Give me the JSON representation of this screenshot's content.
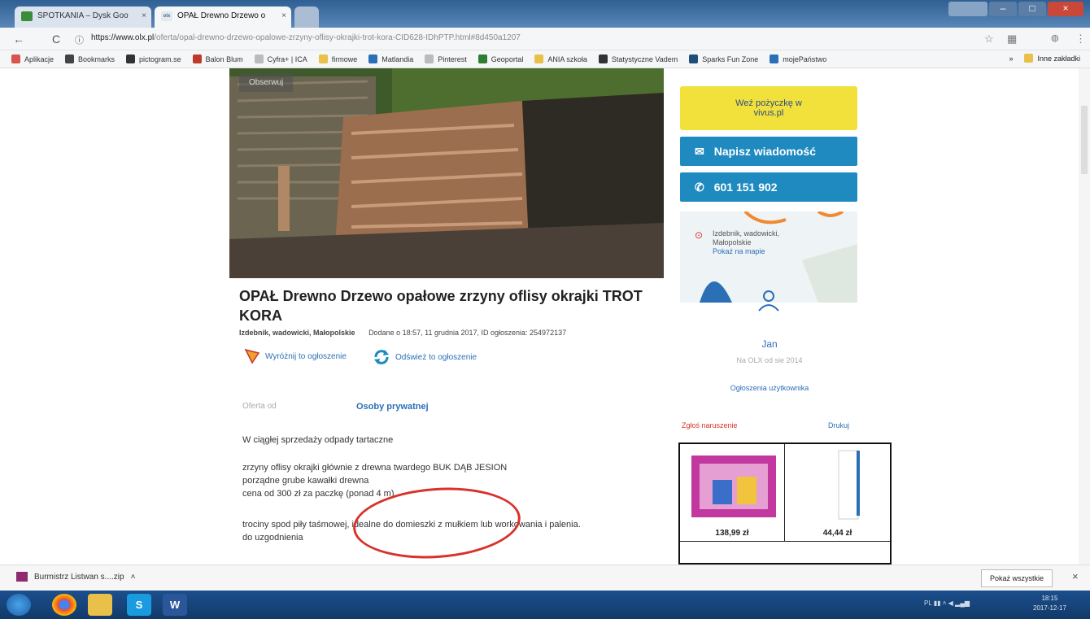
{
  "browser": {
    "tabs": [
      {
        "label": "SPOTKANIA – Dysk Goo",
        "active": false
      },
      {
        "label": "OPAŁ Drewno Drzewo o",
        "active": true
      }
    ],
    "url_host": "https://www.olx.pl",
    "url_path": "/oferta/opal-drewno-drzewo-opalowe-zrzyny-oflisy-okrajki-trot-kora-CID628-IDhPTP.html#8d450a1207",
    "bookmarks": [
      {
        "label": "Aplikacje",
        "icon": "apps-grid-icon",
        "color": "#d9534f"
      },
      {
        "label": "Bookmarks",
        "icon": "star-icon",
        "color": "#444444"
      },
      {
        "label": "pictogram.se",
        "icon": "p-square-icon",
        "color": "#333333"
      },
      {
        "label": "Balon Blum",
        "icon": "balloon-icon",
        "color": "#c0392b"
      },
      {
        "label": "Cyfra+ | ICA",
        "icon": "page-icon",
        "color": "#bbbbbb"
      },
      {
        "label": "firmowe",
        "icon": "folder-icon",
        "color": "#e8c04a"
      },
      {
        "label": "Matlandia",
        "icon": "m-logo-icon",
        "color": "#2b6fb6"
      },
      {
        "label": "Pinterest",
        "icon": "page-icon",
        "color": "#bbbbbb"
      },
      {
        "label": "Geoportal",
        "icon": "geoportal-icon",
        "color": "#2e7d32"
      },
      {
        "label": "ANIA szkoła",
        "icon": "folder-icon",
        "color": "#e8c04a"
      },
      {
        "label": "Statystyczne Vadem",
        "icon": "stats-icon",
        "color": "#333333"
      },
      {
        "label": "Sparks Fun Zone",
        "icon": "sparks-icon",
        "color": "#1f4e79"
      },
      {
        "label": "mojePaństwo",
        "icon": "hexagon-icon",
        "color": "#2b6fb6"
      }
    ],
    "other_bookmarks": "Inne zakładki"
  },
  "ad": {
    "observe_label": "Obserwuj",
    "title": "OPAŁ Drewno Drzewo opałowe zrzyny oflisy okrajki TROT KORA",
    "location": "Izdebnik, wadowicki, Małopolskie",
    "added": "Dodane o 18:57, 11 grudnia 2017, ID ogłoszenia: 254972137",
    "feature_label": "Wyróżnij to ogłoszenie",
    "refresh_label": "Odśwież to ogłoszenie",
    "offer_from_label": "Oferta od",
    "offer_from_value": "Osoby prywatnej",
    "description": [
      "W ciągłej sprzedaży odpady tartaczne",
      "",
      "zrzyny oflisy okrajki głównie z drewna twardego BUK DĄB JESION",
      "porządne grube kawałki drewna",
      "cena od 300 zł za paczkę (ponad 4 m)",
      "",
      "trociny spod piły taśmowej, idealne do domieszki z mułkiem lub workowania i palenia.",
      "do uzgodnienia"
    ]
  },
  "sidebar": {
    "loan_line1": "Weź pożyczkę w",
    "loan_line2": "vivus.pl",
    "message_label": "Napisz wiadomość",
    "phone": "601 151 902",
    "map_location_line1": "Izdebnik, wadowicki,",
    "map_location_line2": "Małopolskie",
    "map_link": "Pokaż na mapie",
    "user_name": "Jan",
    "user_since": "Na OLX od sie 2014",
    "user_ads_link": "Ogłoszenia użytkownika",
    "report_label": "Zgłoś naruszenie",
    "print_label": "Drukuj",
    "ads": [
      {
        "price": "138,99 zł"
      },
      {
        "price": "44,44 zł"
      }
    ]
  },
  "downloads": {
    "file": "Burmistrz Listwan s....zip",
    "show_all": "Pokaż wszystkie"
  },
  "taskbar": {
    "clock_time": "18:15",
    "clock_date": "2017-12-17",
    "tray_lang": "PL"
  },
  "colors": {
    "olx_blue": "#1e8ac0",
    "loan_yellow": "#f2e13b",
    "link_blue": "#2b6fb6",
    "annotation_red": "#d8322a"
  }
}
